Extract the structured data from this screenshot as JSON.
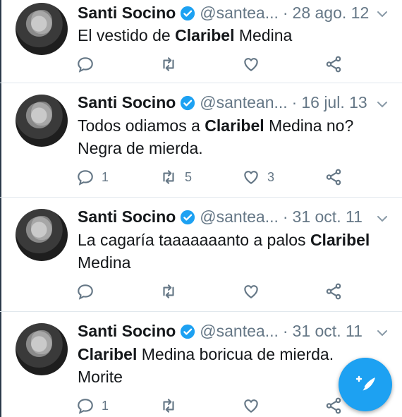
{
  "tweets": [
    {
      "name": "Santi Socino",
      "handle": "@santea...",
      "date": "28 ago. 12",
      "text_pre": "El vestido de ",
      "text_bold": "Claribel",
      "text_post": " Medina",
      "replies": "",
      "retweets": "",
      "likes": ""
    },
    {
      "name": "Santi Socino",
      "handle": "@santean...",
      "date": "16 jul. 13",
      "text_pre": "Todos odiamos a ",
      "text_bold": "Claribel",
      "text_post": " Medina no? Negra de mierda.",
      "replies": "1",
      "retweets": "5",
      "likes": "3"
    },
    {
      "name": "Santi Socino",
      "handle": "@santea...",
      "date": "31 oct. 11",
      "text_pre": "La cagaría taaaaaaanto a palos ",
      "text_bold": "Claribel",
      "text_post": " Medina",
      "replies": "",
      "retweets": "",
      "likes": ""
    },
    {
      "name": "Santi Socino",
      "handle": "@santea...",
      "date": "31 oct. 11",
      "text_pre": "",
      "text_bold": "Claribel",
      "text_post": " Medina boricua de mierda. Morite",
      "replies": "1",
      "retweets": "",
      "likes": ""
    }
  ],
  "separator": "·",
  "colors": {
    "accent": "#1da1f2",
    "muted": "#657786",
    "text": "#14171a",
    "border": "#e1e8ed"
  },
  "icons": [
    "verified-badge-icon",
    "chevron-down-icon",
    "reply-icon",
    "retweet-icon",
    "like-icon",
    "share-icon",
    "compose-tweet-icon"
  ]
}
